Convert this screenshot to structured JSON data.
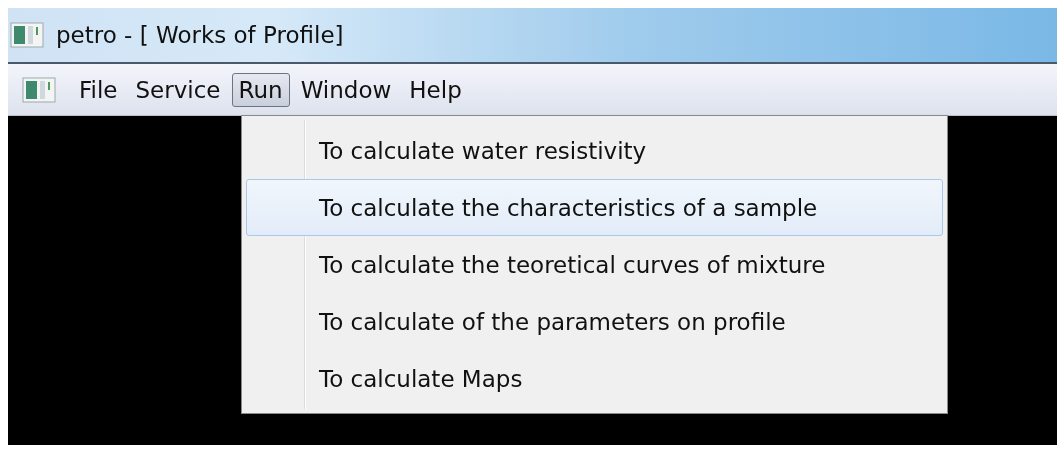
{
  "window": {
    "title": "petro - [ Works of Profile]"
  },
  "menu_bar": [
    {
      "label": "File",
      "selected": false
    },
    {
      "label": "Service",
      "selected": false
    },
    {
      "label": "Run",
      "selected": true
    },
    {
      "label": "Window",
      "selected": false
    },
    {
      "label": "Help",
      "selected": false
    }
  ],
  "dropdown": [
    {
      "label": "To calculate water resistivity",
      "selected": false
    },
    {
      "label": "To calculate the characteristics of a sample",
      "selected": true
    },
    {
      "label": "To calculate the teoretical curves of mixture",
      "selected": false
    },
    {
      "label": "To calculate of the parameters on profile",
      "selected": false
    },
    {
      "label": "To calculate Maps",
      "selected": false
    }
  ]
}
